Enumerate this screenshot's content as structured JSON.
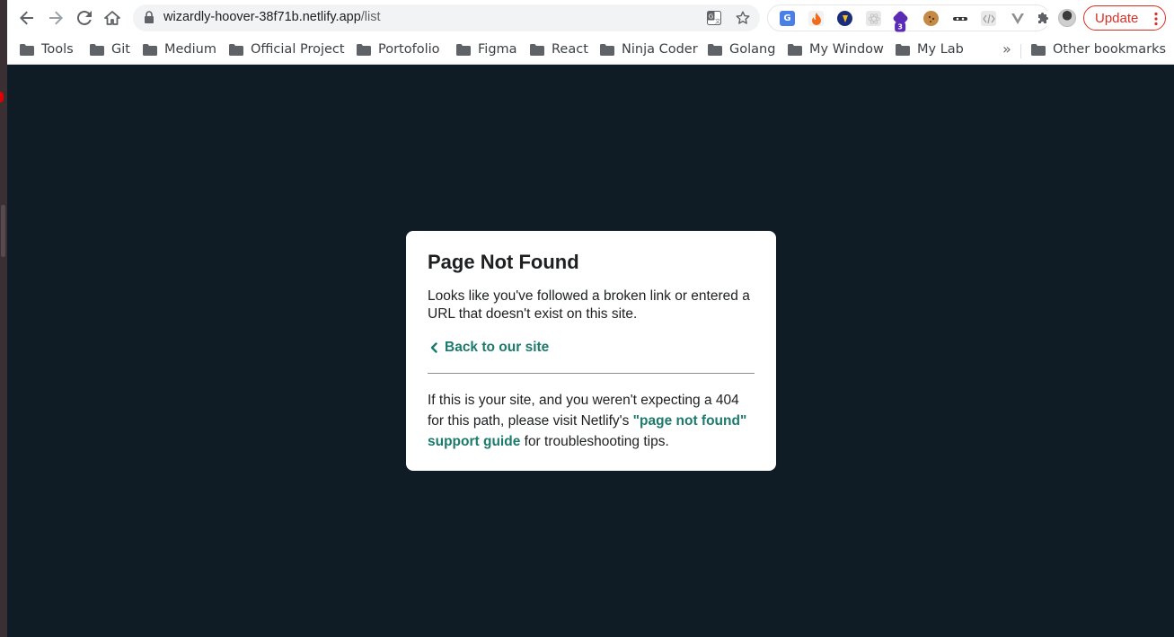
{
  "browser": {
    "url_host": "wizardly-hoover-38f71b.netlify.app",
    "url_path": "/list",
    "update_label": "Update",
    "extension_badge_count": "3",
    "icons": {
      "back": "back-arrow-icon",
      "forward": "forward-arrow-icon",
      "reload": "reload-icon",
      "home": "home-icon",
      "lock": "lock-icon",
      "translate": "translate-icon",
      "bookmark_star": "star-icon",
      "extensions": "puzzle-icon",
      "menu": "kebab-menu-icon"
    },
    "colors": {
      "update_accent": "#d93025"
    }
  },
  "bookmarks": {
    "items": [
      {
        "label": "Tools"
      },
      {
        "label": "Git"
      },
      {
        "label": "Medium"
      },
      {
        "label": "Official Project"
      },
      {
        "label": "Portofolio"
      },
      {
        "label": "Figma"
      },
      {
        "label": "React"
      },
      {
        "label": "Ninja Coder"
      },
      {
        "label": "Golang"
      },
      {
        "label": "My Window"
      },
      {
        "label": "My Lab"
      }
    ],
    "overflow_label": "»",
    "other_label": "Other bookmarks"
  },
  "page": {
    "background_color": "#0f1c25",
    "link_color": "#1c7a6c",
    "title": "Page Not Found",
    "message": "Looks like you've followed a broken link or entered a URL that doesn't exist on this site.",
    "back_link": "Back to our site",
    "hint_prefix": "If this is your site, and you weren't expecting a 404 for this path, please visit Netlify's ",
    "hint_link": "\"page not found\" support guide",
    "hint_suffix": " for troubleshooting tips."
  }
}
